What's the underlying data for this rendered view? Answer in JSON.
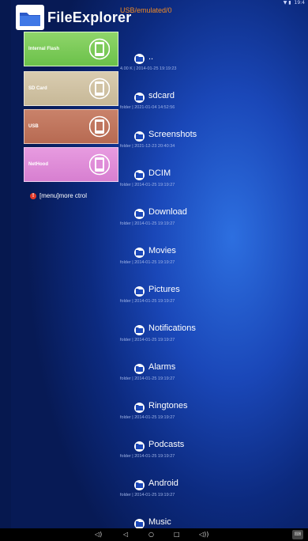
{
  "app": {
    "title": "FileExplorer",
    "path": "USB/emulated/0"
  },
  "status_bar": {
    "left": "",
    "right_icons": "▼ ▮",
    "time": "19:4"
  },
  "sidebar": {
    "items": [
      {
        "label": "Internal Flash",
        "color": "#7cc95a",
        "icon": "flash-icon",
        "selected": true
      },
      {
        "label": "SD Card",
        "color": "#d1c3a4",
        "icon": "sdcard-icon",
        "selected": false
      },
      {
        "label": "USB",
        "color": "#bf7660",
        "icon": "usb-icon",
        "selected": false
      },
      {
        "label": "NetHood",
        "color": "#df8dd9",
        "icon": "nethood-icon",
        "selected": false
      }
    ],
    "menu_hint": "[menu]more ctrol"
  },
  "files": [
    {
      "name": "..",
      "meta": "4.00 K | 2014-01-25 19:19:23"
    },
    {
      "name": "sdcard",
      "meta": "folder | 2021-01-04 14:52:56"
    },
    {
      "name": "Screenshots",
      "meta": "folder | 2021-12-23 20:40:34"
    },
    {
      "name": "DCIM",
      "meta": "folder | 2014-01-25 19:19:27"
    },
    {
      "name": "Download",
      "meta": "folder | 2014-01-25 19:19:27"
    },
    {
      "name": "Movies",
      "meta": "folder | 2014-01-25 19:19:27"
    },
    {
      "name": "Pictures",
      "meta": "folder | 2014-01-25 19:19:27"
    },
    {
      "name": "Notifications",
      "meta": "folder | 2014-01-25 19:19:27"
    },
    {
      "name": "Alarms",
      "meta": "folder | 2014-01-25 19:19:27"
    },
    {
      "name": "Ringtones",
      "meta": "folder | 2014-01-25 19:19:27"
    },
    {
      "name": "Podcasts",
      "meta": "folder | 2014-01-25 19:19:27"
    },
    {
      "name": "Android",
      "meta": "folder | 2014-01-25 19:19:27"
    },
    {
      "name": "Music",
      "meta": ""
    }
  ],
  "navbar": {
    "icons": [
      "volume-down-icon",
      "back-icon",
      "home-icon",
      "recents-icon",
      "volume-up-icon",
      "keyboard-icon"
    ]
  }
}
